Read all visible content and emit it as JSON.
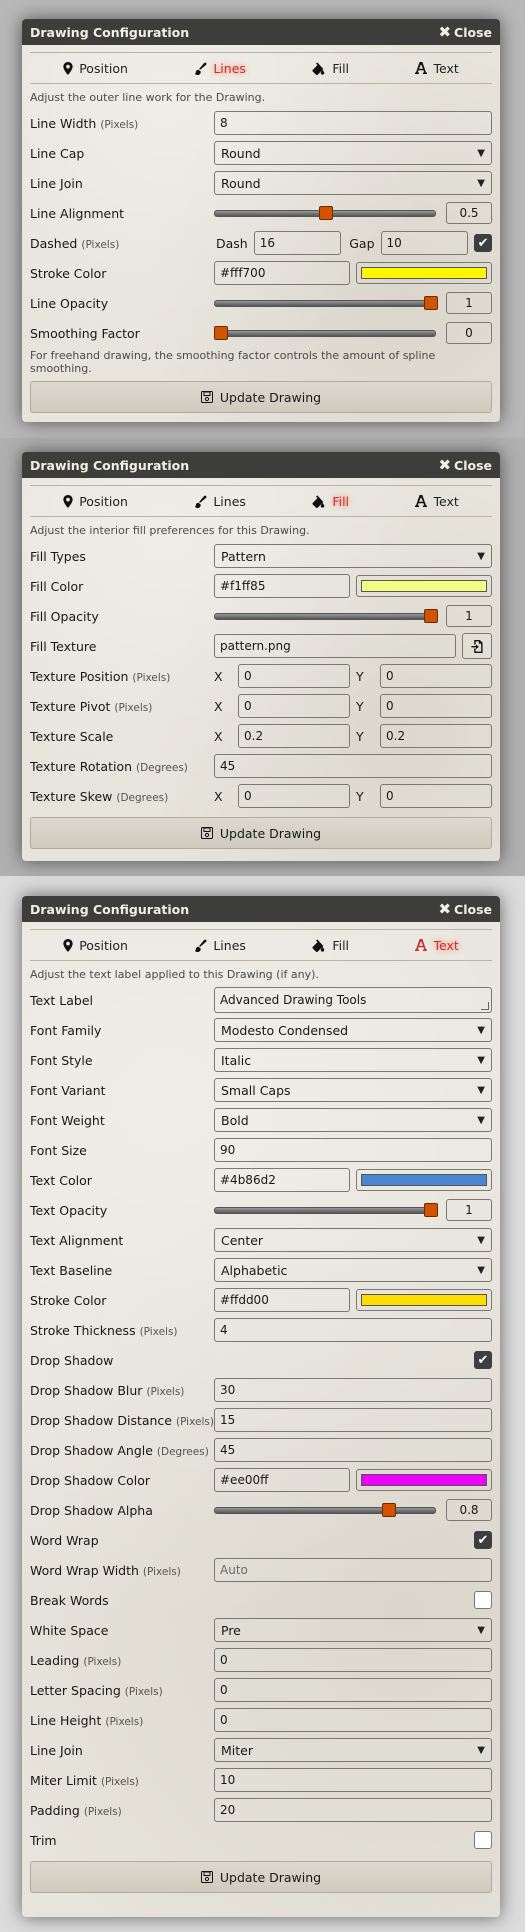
{
  "window_title": "Drawing Configuration",
  "close_label": "Close",
  "tabs": {
    "position": "Position",
    "lines": "Lines",
    "fill": "Fill",
    "text": "Text"
  },
  "update_label": "Update Drawing",
  "colors": {
    "accent": "#d35400",
    "active_tab": "#c4312a",
    "titlebar": "#3d3d3b"
  },
  "lines": {
    "hint": "Adjust the outer line work for the Drawing.",
    "line_width": {
      "label": "Line Width",
      "units": "(Pixels)",
      "value": "8"
    },
    "line_cap": {
      "label": "Line Cap",
      "value": "Round"
    },
    "line_join": {
      "label": "Line Join",
      "value": "Round"
    },
    "line_alignment": {
      "label": "Line Alignment",
      "value": "0.5",
      "fraction": 0.5
    },
    "dashed": {
      "label": "Dashed",
      "units": "(Pixels)",
      "dash_label": "Dash",
      "dash": "16",
      "gap_label": "Gap",
      "gap": "10",
      "checked": true
    },
    "stroke_color": {
      "label": "Stroke Color",
      "value": "#fff700",
      "swatch": "#fff700"
    },
    "line_opacity": {
      "label": "Line Opacity",
      "value": "1",
      "fraction": 1.0
    },
    "smoothing": {
      "label": "Smoothing Factor",
      "value": "0",
      "fraction": 0.0
    },
    "smoothing_note": "For freehand drawing, the smoothing factor controls the amount of spline smoothing."
  },
  "fill": {
    "hint": "Adjust the interior fill preferences for this Drawing.",
    "fill_types": {
      "label": "Fill Types",
      "value": "Pattern"
    },
    "fill_color": {
      "label": "Fill Color",
      "value": "#f1ff85",
      "swatch": "#f1ff85"
    },
    "fill_opacity": {
      "label": "Fill Opacity",
      "value": "1",
      "fraction": 1.0
    },
    "fill_texture": {
      "label": "Fill Texture",
      "value": "pattern.png"
    },
    "texture_position": {
      "label": "Texture Position",
      "units": "(Pixels)",
      "x": "0",
      "y": "0"
    },
    "texture_pivot": {
      "label": "Texture Pivot",
      "units": "(Pixels)",
      "x": "0",
      "y": "0"
    },
    "texture_scale": {
      "label": "Texture Scale",
      "x": "0.2",
      "y": "0.2"
    },
    "texture_rotation": {
      "label": "Texture Rotation",
      "units": "(Degrees)",
      "value": "45"
    },
    "texture_skew": {
      "label": "Texture Skew",
      "units": "(Degrees)",
      "x": "0",
      "y": "0"
    },
    "x_label": "X",
    "y_label": "Y"
  },
  "text": {
    "hint": "Adjust the text label applied to this Drawing (if any).",
    "text_label": {
      "label": "Text Label",
      "value": "Advanced Drawing Tools"
    },
    "font_family": {
      "label": "Font Family",
      "value": "Modesto Condensed"
    },
    "font_style": {
      "label": "Font Style",
      "value": "Italic"
    },
    "font_variant": {
      "label": "Font Variant",
      "value": "Small Caps"
    },
    "font_weight": {
      "label": "Font Weight",
      "value": "Bold"
    },
    "font_size": {
      "label": "Font Size",
      "value": "90"
    },
    "text_color": {
      "label": "Text Color",
      "value": "#4b86d2",
      "swatch": "#4b86d2"
    },
    "text_opacity": {
      "label": "Text Opacity",
      "value": "1",
      "fraction": 1.0
    },
    "text_alignment": {
      "label": "Text Alignment",
      "value": "Center"
    },
    "text_baseline": {
      "label": "Text Baseline",
      "value": "Alphabetic"
    },
    "stroke_color": {
      "label": "Stroke Color",
      "value": "#ffdd00",
      "swatch": "#ffdd00"
    },
    "stroke_thickness": {
      "label": "Stroke Thickness",
      "units": "(Pixels)",
      "value": "4"
    },
    "drop_shadow": {
      "label": "Drop Shadow",
      "checked": true
    },
    "drop_shadow_blur": {
      "label": "Drop Shadow Blur",
      "units": "(Pixels)",
      "value": "30"
    },
    "drop_shadow_distance": {
      "label": "Drop Shadow Distance",
      "units": "(Pixels)",
      "value": "15"
    },
    "drop_shadow_angle": {
      "label": "Drop Shadow Angle",
      "units": "(Degrees)",
      "value": "45"
    },
    "drop_shadow_color": {
      "label": "Drop Shadow Color",
      "value": "#ee00ff",
      "swatch": "#ee00ff"
    },
    "drop_shadow_alpha": {
      "label": "Drop Shadow Alpha",
      "value": "0.8",
      "fraction": 0.8
    },
    "word_wrap": {
      "label": "Word Wrap",
      "checked": true
    },
    "word_wrap_width": {
      "label": "Word Wrap Width",
      "units": "(Pixels)",
      "placeholder": "Auto"
    },
    "break_words": {
      "label": "Break Words",
      "checked": false
    },
    "white_space": {
      "label": "White Space",
      "value": "Pre"
    },
    "leading": {
      "label": "Leading",
      "units": "(Pixels)",
      "value": "0"
    },
    "letter_spacing": {
      "label": "Letter Spacing",
      "units": "(Pixels)",
      "value": "0"
    },
    "line_height": {
      "label": "Line Height",
      "units": "(Pixels)",
      "value": "0"
    },
    "line_join": {
      "label": "Line Join",
      "value": "Miter"
    },
    "miter_limit": {
      "label": "Miter Limit",
      "units": "(Pixels)",
      "value": "10"
    },
    "padding": {
      "label": "Padding",
      "units": "(Pixels)",
      "value": "20"
    },
    "trim": {
      "label": "Trim",
      "checked": false
    }
  }
}
